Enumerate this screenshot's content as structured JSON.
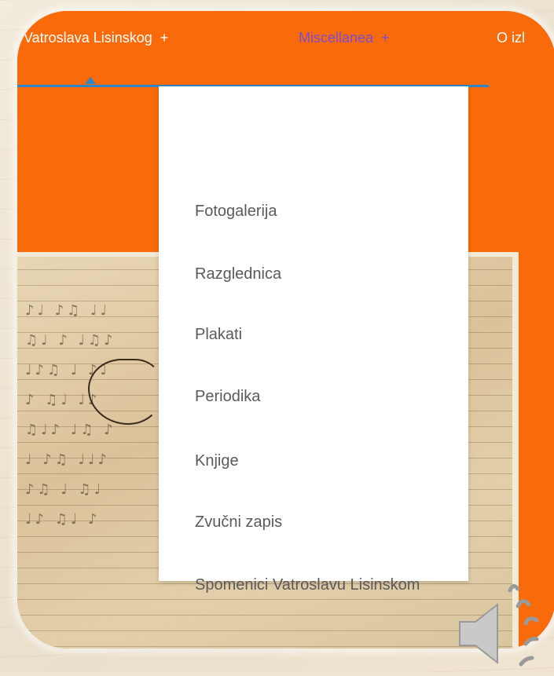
{
  "nav": {
    "items": [
      {
        "label": "Vatroslava Lisinskog",
        "has_submenu": true
      },
      {
        "label": "Miscellanea",
        "has_submenu": true,
        "active": true
      },
      {
        "label": "O izl"
      }
    ],
    "plus_symbol": "+",
    "accent_color": "#2f86c9",
    "active_color": "#7a4ed0"
  },
  "dropdown": {
    "items": [
      {
        "label": "Fotogalerija"
      },
      {
        "label": "Razglednica"
      },
      {
        "label": "Plakati"
      },
      {
        "label": "Periodika"
      },
      {
        "label": "Knjige"
      },
      {
        "label": "Zvučni zapis"
      },
      {
        "label": "Spomenici Vatroslavu Lisinskom"
      }
    ]
  },
  "card": {
    "background_color": "#f86a0a"
  },
  "audio": {
    "icon": "speaker-icon"
  }
}
